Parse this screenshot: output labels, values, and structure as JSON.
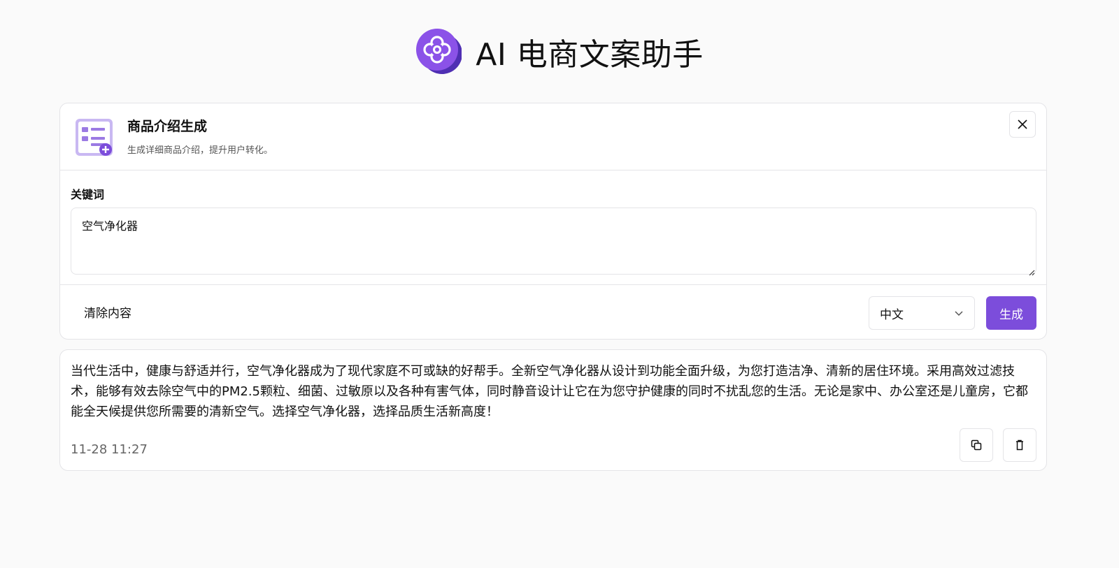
{
  "header": {
    "title": "AI 电商文案助手",
    "logo_icon": "clover-logo-icon",
    "brand_color": "#7c4ddb"
  },
  "generator": {
    "icon": "document-add-icon",
    "title": "商品介绍生成",
    "subtitle": "生成详细商品介绍，提升用户转化。",
    "close_icon": "close-icon",
    "keyword_label": "关键词",
    "keyword_value": "空气净化器",
    "clear_label": "清除内容",
    "language_value": "中文",
    "generate_label": "生成"
  },
  "result": {
    "text": "当代生活中，健康与舒适并行，空气净化器成为了现代家庭不可或缺的好帮手。全新空气净化器从设计到功能全面升级，为您打造洁净、清新的居住环境。采用高效过滤技术，能够有效去除空气中的PM2.5颗粒、细菌、过敏原以及各种有害气体，同时静音设计让它在为您守护健康的同时不扰乱您的生活。无论是家中、办公室还是儿童房，它都能全天候提供您所需要的清新空气。选择空气净化器，选择品质生活新高度！",
    "timestamp": "11-28 11:27",
    "copy_icon": "copy-icon",
    "delete_icon": "trash-icon"
  }
}
